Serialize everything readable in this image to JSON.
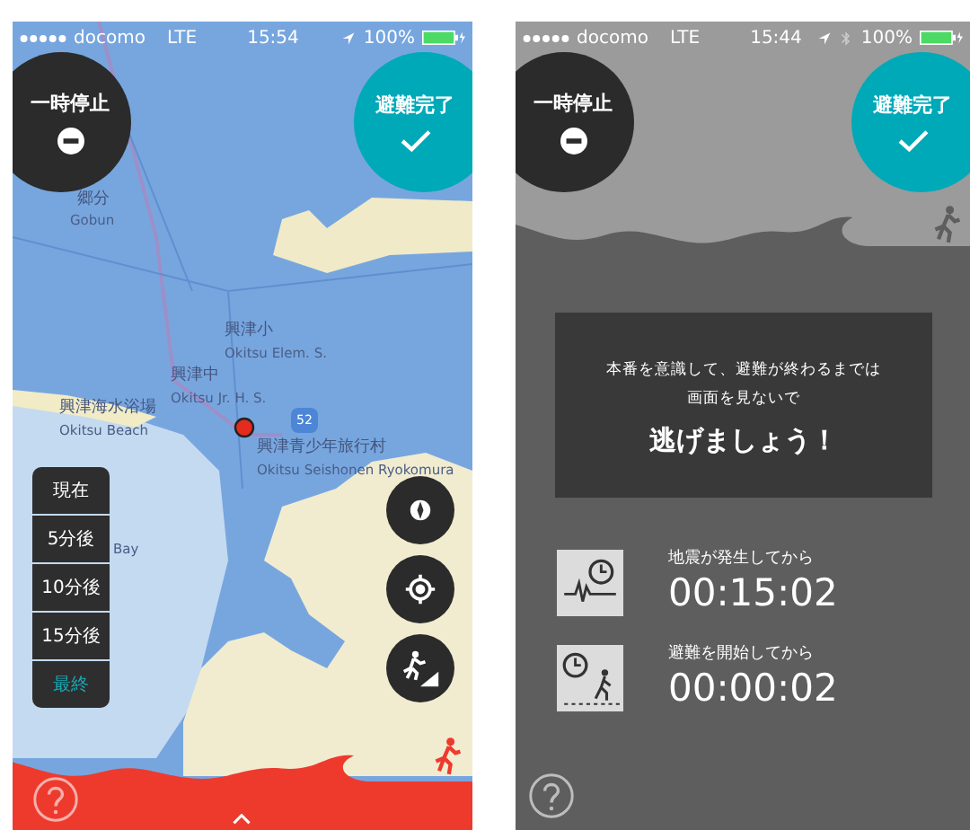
{
  "screens": [
    {
      "kind": "map",
      "status_bar": {
        "carrier": "docomo",
        "network": "LTE",
        "time": "15:54",
        "battery": "100%",
        "bluetooth": false
      },
      "pause_button": {
        "label": "一時停止"
      },
      "done_button": {
        "label": "避難完了"
      },
      "map_labels": [
        {
          "text": "郷分",
          "kind": "name"
        },
        {
          "text": "Gobun",
          "kind": "roman"
        },
        {
          "text": "興津小",
          "kind": "name"
        },
        {
          "text": "Okitsu Elem. S.",
          "kind": "roman"
        },
        {
          "text": "興津中",
          "kind": "name"
        },
        {
          "text": "Okitsu Jr. H. S.",
          "kind": "roman"
        },
        {
          "text": "興津海水浴場",
          "kind": "name"
        },
        {
          "text": "Okitsu Beach",
          "kind": "roman"
        },
        {
          "text": "興津青少年旅行村",
          "kind": "name"
        },
        {
          "text": "Okitsu Seishonen Ryokomura",
          "kind": "roman"
        },
        {
          "text": "Bay",
          "kind": "roman"
        }
      ],
      "route_shield": "52",
      "time_options": [
        {
          "label": "現在",
          "selected": false
        },
        {
          "label": "5分後",
          "selected": false
        },
        {
          "label": "10分後",
          "selected": false
        },
        {
          "label": "15分後",
          "selected": false
        },
        {
          "label": "最終",
          "selected": true
        }
      ]
    },
    {
      "kind": "countdown",
      "status_bar": {
        "carrier": "docomo",
        "network": "LTE",
        "time": "15:44",
        "battery": "100%",
        "bluetooth": true
      },
      "pause_button": {
        "label": "一時停止"
      },
      "done_button": {
        "label": "避難完了"
      },
      "message": {
        "lines": [
          "本番を意識して、避難が終わるまでは",
          "画面を見ないで"
        ],
        "headline": "逃げましょう！"
      },
      "timers": [
        {
          "kind": "quake",
          "label": "地震が発生してから",
          "value": "00:15:02"
        },
        {
          "kind": "evacuation",
          "label": "避難を開始してから",
          "value": "00:00:02"
        }
      ]
    }
  ]
}
